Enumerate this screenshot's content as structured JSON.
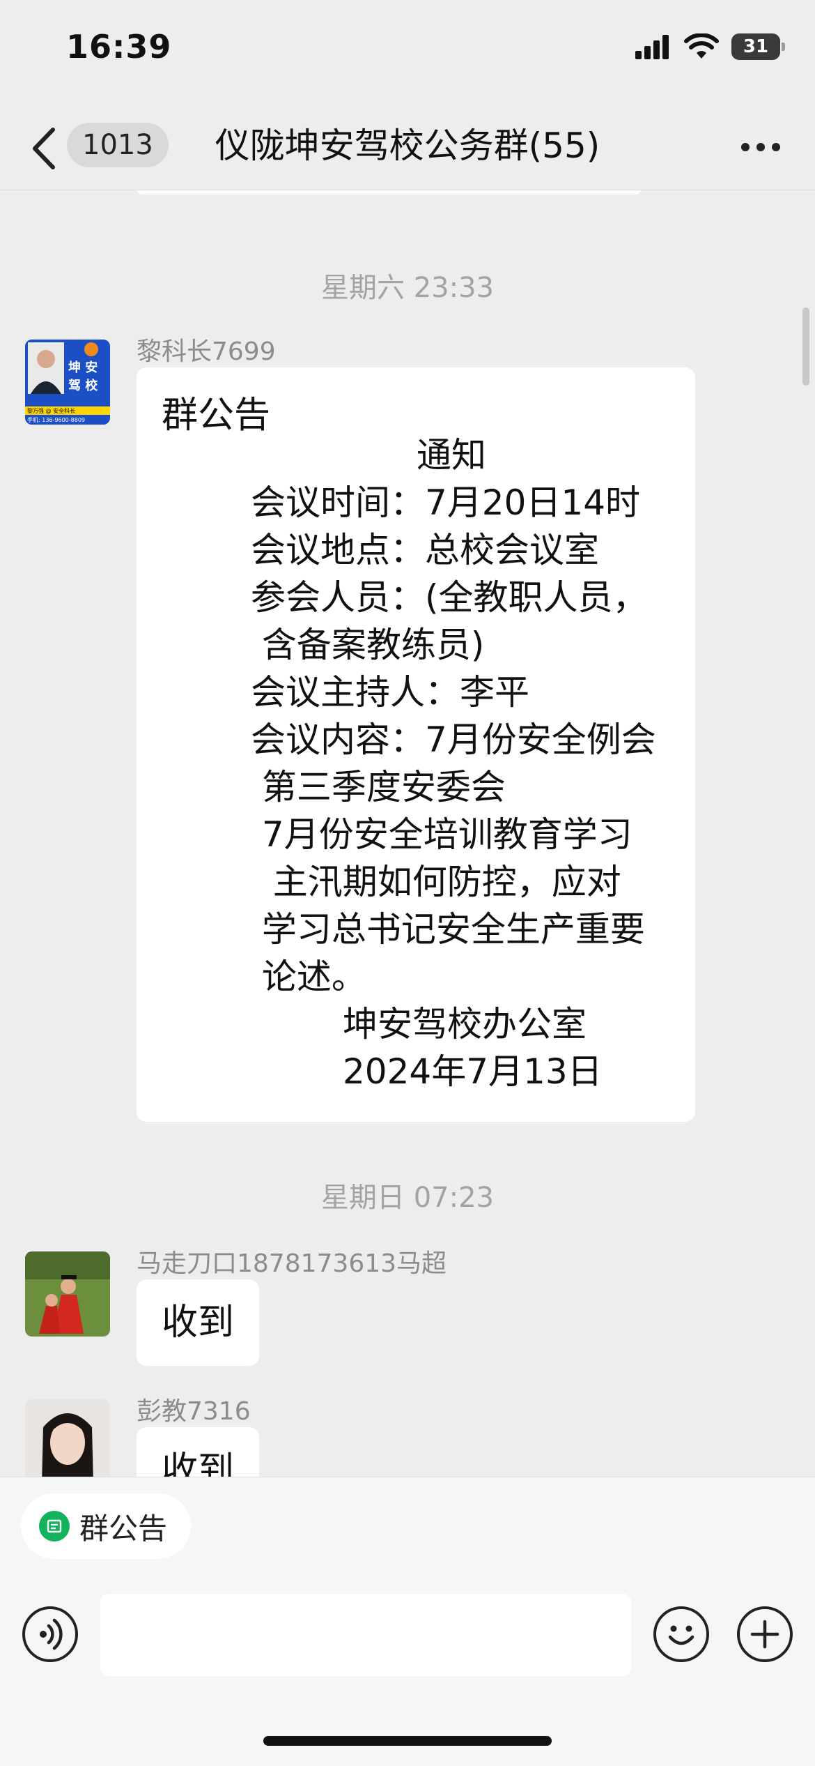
{
  "status_bar": {
    "time": "16:39",
    "battery": "31"
  },
  "nav": {
    "badge": "1013",
    "title": "仪陇坤安驾校公务群(55)"
  },
  "messages": {
    "ts1": "星期六 23:33",
    "m1": {
      "sender": "黎科长7699",
      "avatar_text1": "坤 安",
      "avatar_text2": "驾 校",
      "avatar_text3": "黎万强 @ 安全科长",
      "avatar_text4": "手机: 136-9600-8809",
      "title": "群公告",
      "lines": [
        "通知",
        "会议时间：7月20日14时",
        "会议地点：总校会议室",
        "参会人员：(全教职人员，",
        " 含备案教练员)",
        "会议主持人：李平",
        "会议内容：7月份安全例会",
        " 第三季度安委会",
        " 7月份安全培训教育学习",
        "  主汛期如何防控，应对",
        " 学习总书记安全生产重要",
        " 论述。",
        "坤安驾校办公室",
        "2024年7月13日"
      ]
    },
    "ts2": "星期日 07:23",
    "m2": {
      "sender": "马走刀口1878173613马超",
      "text": "收到"
    },
    "m3": {
      "sender": "彭教7316",
      "text": "收到"
    }
  },
  "bottom": {
    "chip_label": "群公告"
  },
  "colors": {
    "accent_green": "#12b35c",
    "background": "#ededed"
  }
}
